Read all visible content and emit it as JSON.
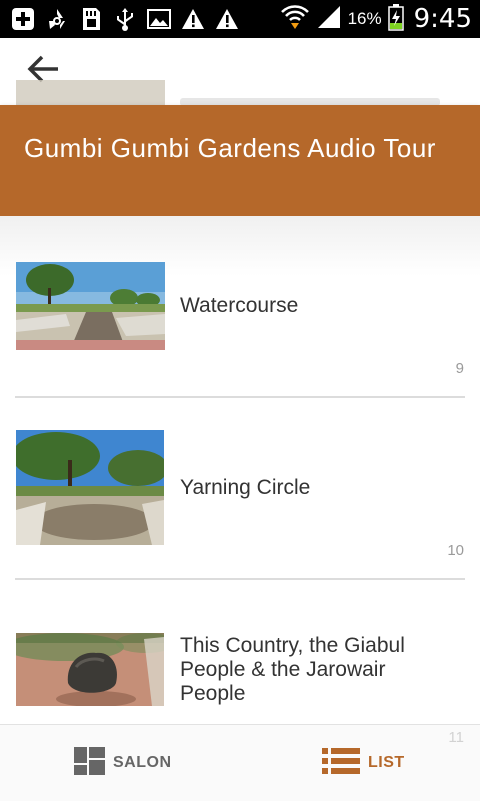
{
  "status_bar": {
    "battery_percent": "16%",
    "time": "9:45",
    "icons": [
      "add-icon",
      "recycle-icon",
      "sd-card-icon",
      "usb-icon",
      "image-icon",
      "warning-icon",
      "warning-icon",
      "wifi-icon",
      "signal-icon",
      "battery-charging-icon"
    ]
  },
  "header": {
    "back_icon": "arrow-left-icon"
  },
  "banner": {
    "title": "Gumbi Gumbi Gardens Audio Tour",
    "color": "#b5682a"
  },
  "items": [
    {
      "title": "Watercourse",
      "number": "9"
    },
    {
      "title": "Yarning Circle",
      "number": "10"
    },
    {
      "title": "This Country, the Giabul People & the Jarowair People",
      "number": "11"
    }
  ],
  "tabs": [
    {
      "label": "SALON",
      "icon": "grid-icon",
      "color": "#666666",
      "selected": false
    },
    {
      "label": "LIST",
      "icon": "list-icon",
      "color": "#b5682a",
      "selected": true
    }
  ]
}
